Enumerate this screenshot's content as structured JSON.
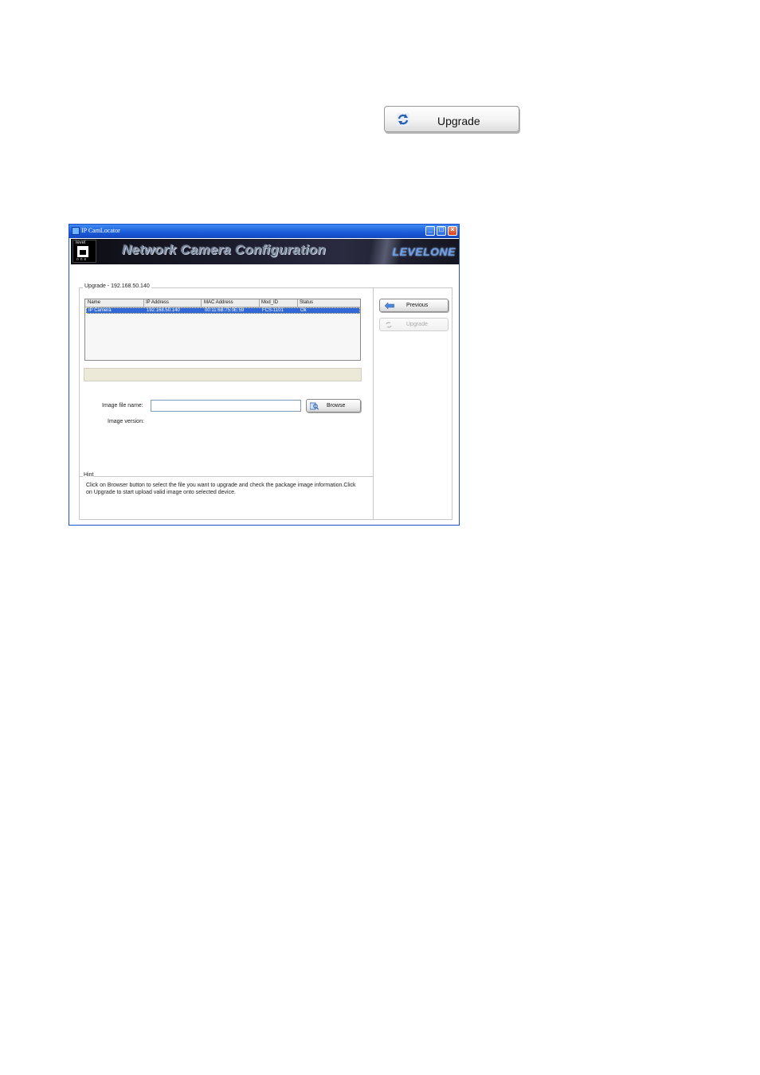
{
  "standalone_button": {
    "label": "Upgrade",
    "icon": "upgrade-icon"
  },
  "window": {
    "title": "IP CamLocator",
    "controls": [
      "minimize",
      "maximize",
      "close"
    ],
    "banner": {
      "logo_top": "level",
      "logo_bottom": "one",
      "title": "Network Camera Configuration",
      "brand": "LEVELONE"
    },
    "group_title": "Upgrade - 192.168.50.140",
    "table": {
      "columns": [
        "Name",
        "IP Address",
        "MAC Address",
        "Mod_ID",
        "Status"
      ],
      "rows": [
        {
          "name": "IP Camera",
          "ip": "192.168.50.140",
          "mac": "00:11:6B:75:0E:59",
          "mod_id": "FCS-1101",
          "status": "Ok",
          "selected": true
        }
      ]
    },
    "image_file_label": "Image file name:",
    "image_file_value": "",
    "image_version_label": "Image version:",
    "browse_label": "Browse",
    "previous_label": "Previous",
    "upgrade_label": "Upgrade",
    "hint_title": "Hint",
    "hint_text": "Click on Browser button to select the file you want to upgrade and check the package image information.Click on Upgrade to start upload valid image onto selected device."
  },
  "colors": {
    "titlebar": "#1a5ad6",
    "selection": "#3168d5",
    "status_bar": "#ece9d8"
  }
}
